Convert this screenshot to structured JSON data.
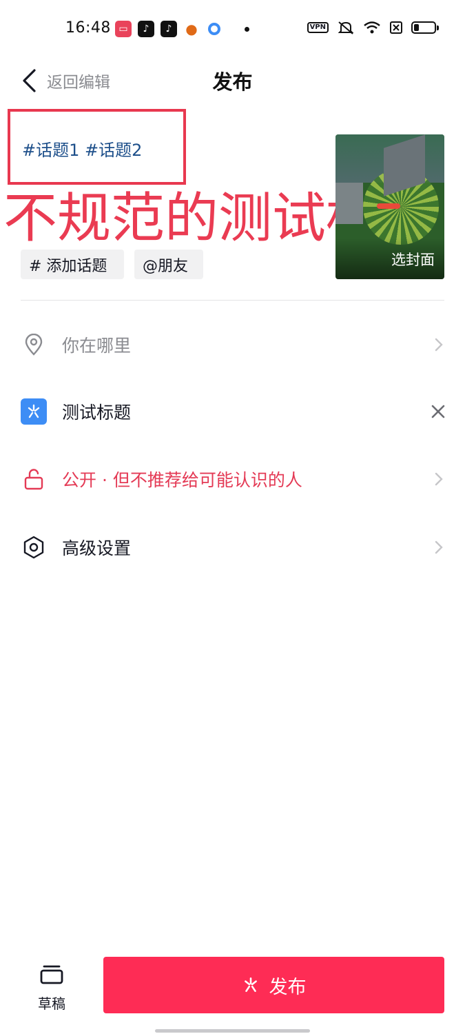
{
  "status_bar": {
    "time": "16:48",
    "vpn_label": "VPN",
    "battery_level": 0.25
  },
  "header": {
    "back_label": "返回编辑",
    "title": "发布"
  },
  "post": {
    "topics_text": "#话题1 #话题2",
    "annotation_overlay": "不规范的测试标题",
    "cover_label": "选封面"
  },
  "chips": {
    "add_topic": "# 添加话题",
    "mention": "@朋友"
  },
  "rows": {
    "location": "你在哪里",
    "mini_program": "测试标题",
    "privacy": "公开 · 但不推荐给可能认识的人",
    "advanced": "高级设置"
  },
  "bottom": {
    "drafts_label": "草稿",
    "publish_label": "发布"
  },
  "colors": {
    "accent": "#fe2c55",
    "privacy_text": "#e43a55",
    "topic_link": "#1d4f8a",
    "annotation_red": "#ea3b52",
    "mini_badge": "#3d8df5"
  }
}
